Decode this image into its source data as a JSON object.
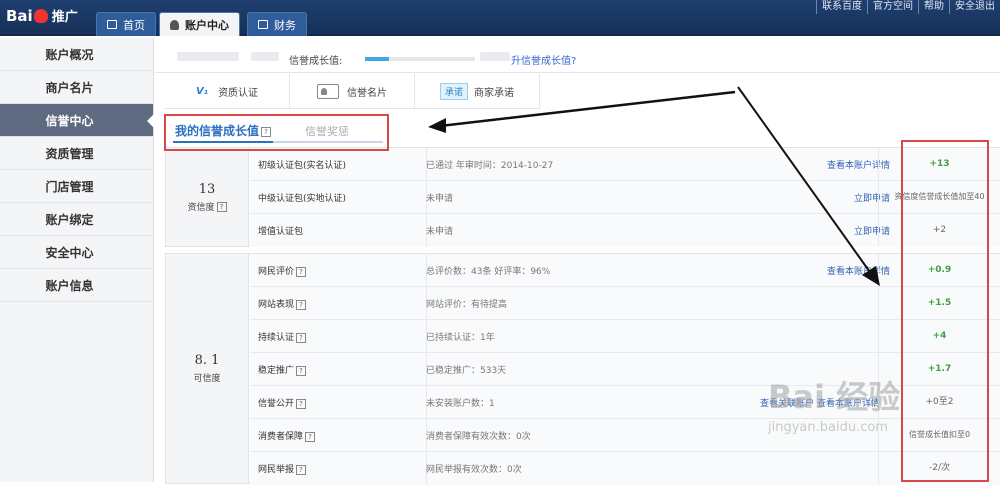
{
  "header": {
    "logo_text": "Bai",
    "logo_suffix": "推广",
    "tabs": [
      {
        "label": "首页",
        "icon": "home-icon"
      },
      {
        "label": "账户中心",
        "icon": "user-icon"
      },
      {
        "label": "财务",
        "icon": "finance-icon"
      }
    ],
    "top_links": [
      "联系百度",
      "官方空间",
      "帮助",
      "安全退出"
    ]
  },
  "sidebar": {
    "items": [
      {
        "label": "账户概况"
      },
      {
        "label": "商户名片"
      },
      {
        "label": "信誉中心"
      },
      {
        "label": "资质管理"
      },
      {
        "label": "门店管理"
      },
      {
        "label": "账户绑定"
      },
      {
        "label": "安全中心"
      },
      {
        "label": "账户信息"
      }
    ],
    "active": "信誉中心"
  },
  "progress": {
    "label": "信誉成长值:",
    "fill_fraction": 0.22,
    "link": "升信誉成长值?"
  },
  "certs": [
    {
      "badge": "V₁",
      "label": "资质认证",
      "icon": "v1-icon"
    },
    {
      "badge": "",
      "label": "信誉名片",
      "icon": "card-icon"
    },
    {
      "badge": "承诺",
      "label": "商家承诺",
      "icon": "promise-badge"
    }
  ],
  "credit_tabs": {
    "active": "我的信誉成长值",
    "inactive": "信誉奖惩",
    "help": "?"
  },
  "qualification": {
    "score": "13",
    "label": "资信度",
    "rows": [
      {
        "name": "初级认证包(实名认证)",
        "status": "已通过  年审时间：2014-10-27",
        "link": "查看本账户详情",
        "score": "+13",
        "green": true
      },
      {
        "name": "中级认证包(实地认证)",
        "status": "未申请",
        "link": "立即申请",
        "score": "资信度信誉成长值加至40",
        "green": false
      },
      {
        "name": "增值认证包",
        "status": "未申请",
        "link": "立即申请",
        "score": "+2",
        "green": false
      }
    ]
  },
  "credibility": {
    "score": "8. 1",
    "label": "可信度",
    "rows": [
      {
        "name": "网民评价",
        "status": "总评价数：43条  好评率：96%",
        "link": "查看本账户详情",
        "score": "+0.9",
        "green": true
      },
      {
        "name": "网站表现",
        "status": "网站评价：有待提高",
        "link": "",
        "score": "+1.5",
        "green": true
      },
      {
        "name": "持续认证",
        "status": "已持续认证：1年",
        "link": "",
        "score": "+4",
        "green": true
      },
      {
        "name": "稳定推广",
        "status": "已稳定推广：533天",
        "link": "",
        "score": "+1.7",
        "green": true
      },
      {
        "name": "信誉公开",
        "status": "未安装账户数：1",
        "link": "查看本账户详情",
        "link2": "查看关联账户",
        "score": "+0至2",
        "green": false
      },
      {
        "name": "消费者保障",
        "status": "消费者保障有效次数：0次",
        "link": "",
        "score": "信誉成长值扣至0",
        "green": false
      },
      {
        "name": "网民举报",
        "status": "网民举报有效次数：0次",
        "link": "",
        "score": "-2/次",
        "green": false
      }
    ]
  },
  "watermark": {
    "big": "Bai 经验",
    "small": "jingyan.baidu.com"
  },
  "colors": {
    "accent": "#2d6fc2",
    "green": "#3ea03e",
    "highlight": "#d94848",
    "nav": "#1f3f70"
  }
}
